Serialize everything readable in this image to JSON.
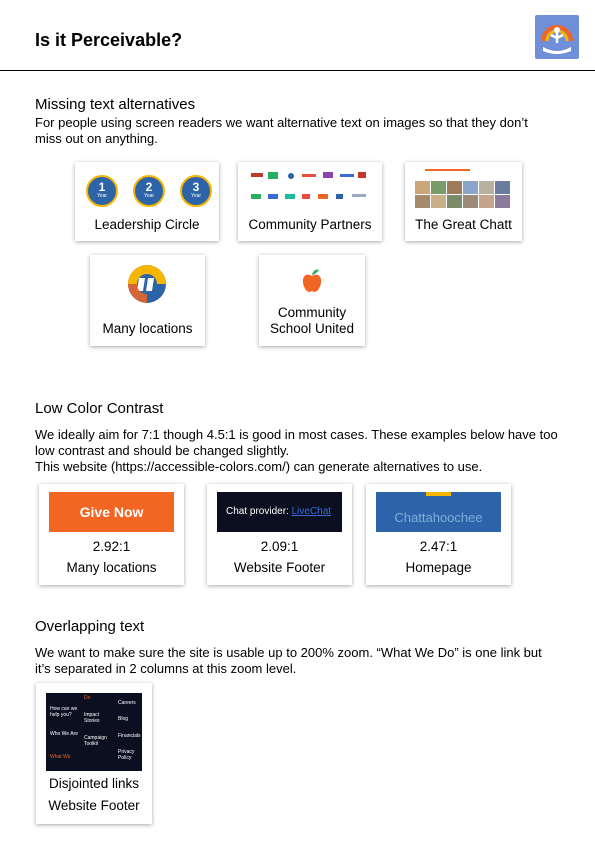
{
  "header": {
    "title": "Is it Perceivable?",
    "logo_icon": "united-way-logo-icon"
  },
  "missing_text": {
    "heading": "Missing text alternatives",
    "description": "For people using screen readers we want alternative text on images so that they don’t miss out on anything.",
    "cards": [
      {
        "label": "Leadership Circle",
        "badges": [
          "1",
          "2",
          "3"
        ],
        "badge_sub": "Year"
      },
      {
        "label": "Community Partners"
      },
      {
        "label": "The Great Chatt"
      },
      {
        "label": "Many locations"
      },
      {
        "label_line1": "Community",
        "label_line2": "School United"
      }
    ]
  },
  "contrast": {
    "heading": "Low Color Contrast",
    "description": "We ideally aim for 7:1 though 4.5:1 is good in most cases. These examples below have too low contrast and should be changed slightly.",
    "description2": "This website (https://accessible-colors.com/) can generate alternatives to use.",
    "cards": [
      {
        "sample": "Give Now",
        "ratio": "2.92:1",
        "label": "Many locations",
        "color": "#f26522"
      },
      {
        "sample_prefix": "Chat provider: ",
        "sample_link": "LiveChat",
        "ratio": "2.09:1",
        "label": "Website Footer",
        "color": "#0b1021"
      },
      {
        "sample": "Chattahoochee",
        "ratio": "2.47:1",
        "label": "Homepage",
        "color": "#2d63a8"
      }
    ]
  },
  "overlap": {
    "heading": "Overlapping text",
    "description": "We want to make sure the site is usable up to 200% zoom. “What We Do” is one link but it’s separated in 2 columns at this zoom level.",
    "card": {
      "label1": "Disjointed links",
      "label2": "Website Footer",
      "footer_links": {
        "how_can": "How can we help you?",
        "who_we_are": "Who We Are",
        "what_we": "What We",
        "do": "Do",
        "impact": "Impact Stories",
        "campaign": "Campaign Toolkit",
        "careers": "Careers",
        "blog": "Blog",
        "financials": "Financials",
        "privacy": "Privacy Policy"
      }
    }
  }
}
